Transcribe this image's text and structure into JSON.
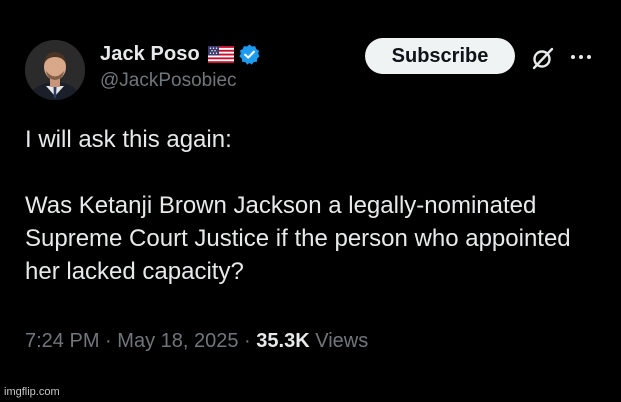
{
  "author": {
    "display_name": "Jack Poso",
    "handle": "@JackPosobiec",
    "flag_icon": "us-flag-icon",
    "verified_icon": "verified-badge-icon",
    "verified_color": "#1d9bf0"
  },
  "actions": {
    "subscribe_label": "Subscribe",
    "grok_icon": "grok-icon",
    "more_icon": "more-options-icon"
  },
  "tweet": {
    "line_1": "I will ask this again:",
    "paragraph_2": "Was Ketanji Brown Jackson a legally-nominated Supreme Court Justice if the person who appointed her lacked capacity?"
  },
  "meta": {
    "time": "7:24 PM",
    "separator": "·",
    "date": "May 18, 2025",
    "views_count": "35.3K",
    "views_label": "Views"
  },
  "watermark": "imgflip.com",
  "colors": {
    "background": "#000000",
    "text_primary": "#e7e9ea",
    "text_secondary": "#71767b",
    "button_bg": "#eff3f4",
    "button_text": "#0f1419"
  }
}
